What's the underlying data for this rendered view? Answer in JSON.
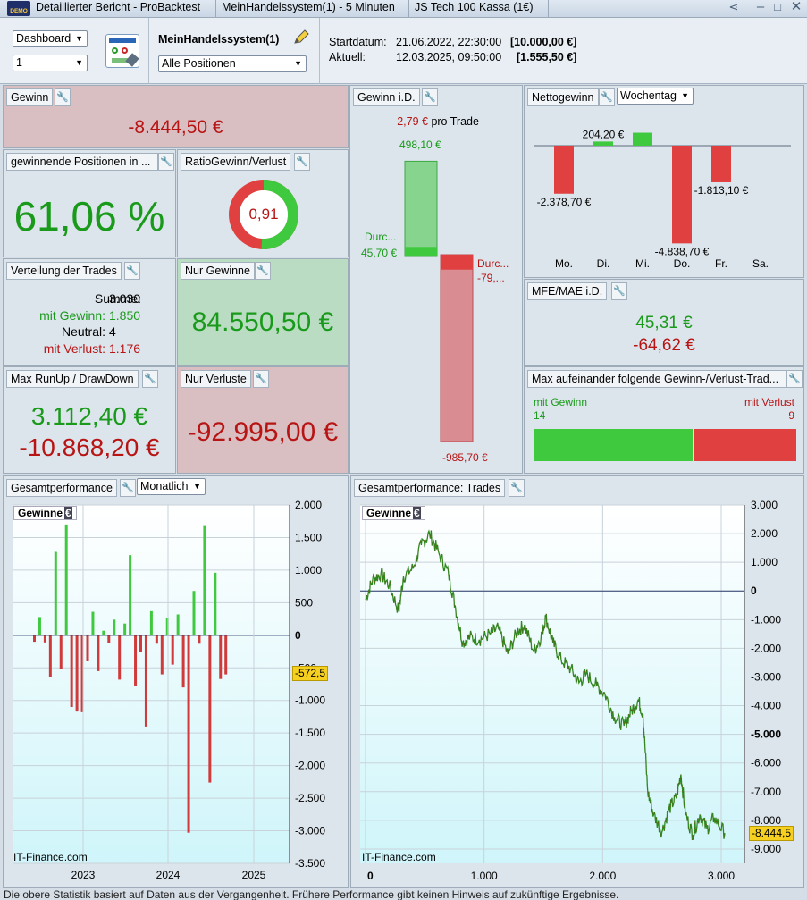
{
  "window": {
    "title": "Detaillierter Bericht - ProBacktest",
    "system_tab": "MeinHandelssystem(1) - 5 Minuten",
    "instrument_tab": "JS Tech 100 Kassa (1€)",
    "demo_badge": "DEMO"
  },
  "toolbar": {
    "view_select": "Dashboard",
    "number_select": "1",
    "system_name": "MeinHandelssystem(1)",
    "positions_select": "Alle Positionen",
    "start_label": "Startdatum:",
    "start_date": "21.06.2022, 22:30:00",
    "start_value": "[10.000,00 €]",
    "current_label": "Aktuell:",
    "current_date": "12.03.2025, 09:50:00",
    "current_value": "[1.555,50 €]"
  },
  "panels": {
    "gewinn": {
      "title": "Gewinn",
      "value": "-8.444,50 €"
    },
    "winning_positions": {
      "title": "gewinnende Positionen in ...",
      "value": "61,06 %"
    },
    "ratio": {
      "title": "RatioGewinn/Verlust",
      "value": "0,91",
      "ratio_fraction": 0.51
    },
    "distribution": {
      "title": "Verteilung der Trades",
      "sum_label": "Summe:",
      "sum_value": "3.030",
      "win_label": "mit Gewinn:",
      "win_value": "1.850",
      "neutral_label": "Neutral:",
      "neutral_value": "4",
      "loss_label": "mit Verlust:",
      "loss_value": "1.176"
    },
    "only_wins": {
      "title": "Nur Gewinne",
      "value": "84.550,50 €"
    },
    "runup": {
      "title": "Max RunUp / DrawDown",
      "runup": "3.112,40 €",
      "drawdown": "-10.868,20 €"
    },
    "only_losses": {
      "title": "Nur Verluste",
      "value": "-92.995,00 €"
    },
    "gewinn_id": {
      "title": "Gewinn i.D.",
      "per_trade_value": "-2,79 €",
      "per_trade_label": "pro Trade",
      "win_max": "498,10 €",
      "win_avg_label": "Durc...",
      "win_avg": "45,70 €",
      "loss_avg_label": "Durc...",
      "loss_avg": "-79,...",
      "loss_max": "-985,70 €",
      "win_max_num": 498.1,
      "win_avg_num": 45.7,
      "loss_avg_num": 79.0,
      "loss_max_num": 985.7
    },
    "nettogewinn": {
      "title": "Nettogewinn",
      "select": "Wochentag",
      "days": [
        "Mo.",
        "Di.",
        "Mi.",
        "Do.",
        "Fr.",
        "Sa."
      ],
      "values": [
        -2378.7,
        204.2,
        640,
        -4838.7,
        -1813.1,
        0
      ],
      "labels": [
        "-2.378,70 €",
        "204,20 €",
        "",
        "-4.838,70 €",
        "-1.813,10 €",
        ""
      ]
    },
    "mfe_mae": {
      "title": "MFE/MAE i.D.",
      "mfe": "45,31 €",
      "mae": "-64,62 €"
    },
    "streaks": {
      "title": "Max aufeinander folgende Gewinn-/Verlust-Trad...",
      "win_label": "mit Gewinn",
      "win_value": "14",
      "loss_label": "mit Verlust",
      "loss_value": "9",
      "win_num": 14,
      "loss_num": 9
    }
  },
  "monthly_chart": {
    "panel_title": "Gesamtperformance",
    "select": "Monatlich",
    "legend": "Gewinne",
    "legend_unit": "€",
    "watermark": "IT-Finance.com",
    "current_value_badge": "-572,5",
    "y_ticks": [
      "2.000",
      "1.500",
      "1.000",
      "500",
      "0",
      "-500",
      "-1.000",
      "-1.500",
      "-2.000",
      "-2.500",
      "-3.000",
      "-3.500"
    ],
    "x_ticks": [
      "2023",
      "2024",
      "2025"
    ]
  },
  "trades_chart": {
    "panel_title": "Gesamtperformance: Trades",
    "legend": "Gewinne",
    "legend_unit": "€",
    "watermark": "IT-Finance.com",
    "current_value_badge": "-8.444,5",
    "y_ticks": [
      "3.000",
      "2.000",
      "1.000",
      "0",
      "-1.000",
      "-2.000",
      "-3.000",
      "-4.000",
      "-5.000",
      "-6.000",
      "-7.000",
      "-8.000",
      "-9.000"
    ],
    "x_ticks": [
      "0",
      "1.000",
      "2.000",
      "3.000"
    ]
  },
  "footer": {
    "text": "Die obere Statistik basiert auf Daten aus der Vergangenheit. Frühere Performance gibt keinen Hinweis auf zukünftige Ergebnisse."
  },
  "chart_data": [
    {
      "type": "bar",
      "title": "Gesamtperformance",
      "ylabel": "Gewinne",
      "x_ticks": [
        "2023",
        "2024",
        "2025"
      ],
      "ylim": [
        -3500,
        2000
      ],
      "series": [
        {
          "values": [
            -100,
            280,
            -110,
            -640,
            1280,
            -510,
            1700,
            -1100,
            -1170,
            -1180,
            -400,
            360,
            -550,
            70,
            -120,
            240,
            -680,
            180,
            1230,
            -770,
            -250,
            -1400,
            370,
            -130,
            -600,
            260,
            -450,
            320,
            -800,
            -3030,
            680,
            -130,
            1690,
            -2260,
            960,
            -670,
            -600
          ]
        }
      ]
    },
    {
      "type": "line",
      "title": "Gesamtperformance: Trades",
      "ylabel": "Gewinne",
      "x_ticks": [
        "0",
        "1.000",
        "2.000",
        "3.000"
      ],
      "ylim": [
        -9500,
        3000
      ],
      "series": [
        {
          "x": [
            0,
            60,
            130,
            200,
            280,
            320,
            400,
            470,
            540,
            620,
            700,
            760,
            820,
            880,
            960,
            1050,
            1120,
            1200,
            1280,
            1340,
            1420,
            1480,
            1520,
            1580,
            1650,
            1730,
            1800,
            1860,
            1950,
            2020,
            2100,
            2180,
            2240,
            2300,
            2340,
            2380,
            2430,
            2500,
            2560,
            2620,
            2660,
            2700,
            2760,
            2820,
            2880,
            2940,
            3030
          ],
          "y": [
            -300,
            400,
            600,
            200,
            -700,
            500,
            800,
            1600,
            2000,
            1300,
            600,
            -600,
            -1800,
            -1600,
            -1700,
            -1500,
            -1300,
            -2200,
            -1400,
            -1200,
            -2100,
            -1600,
            -900,
            -1800,
            -2400,
            -2700,
            -3200,
            -2900,
            -3300,
            -3600,
            -4400,
            -4700,
            -4200,
            -3800,
            -4300,
            -7000,
            -7800,
            -8400,
            -7600,
            -7200,
            -6400,
            -7800,
            -8500,
            -7800,
            -8300,
            -7900,
            -8444.5
          ]
        }
      ]
    }
  ]
}
